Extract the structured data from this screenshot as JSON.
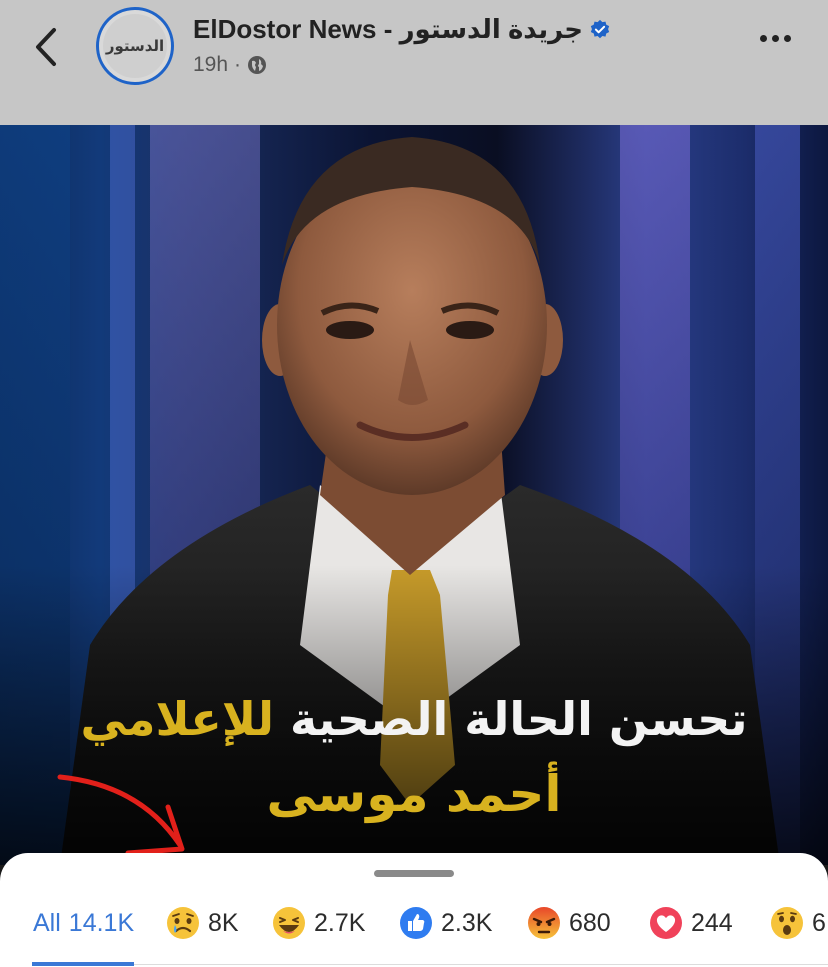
{
  "header": {
    "page_name": "ElDostor News - جريدة الدستور",
    "time": "19h",
    "dot": "·",
    "avatar_text": "الدستور"
  },
  "post": {
    "headline_line1_white": "تحسن الحالة الصحية",
    "headline_line1_gold": "للإعلامي",
    "headline_line2": "أحمد موسى"
  },
  "reactions": {
    "all": {
      "label": "All",
      "count": "14.1K"
    },
    "tabs": [
      {
        "icon": "sad-emoji-icon",
        "count": "8K"
      },
      {
        "icon": "haha-emoji-icon",
        "count": "2.7K"
      },
      {
        "icon": "like-icon",
        "count": "2.3K"
      },
      {
        "icon": "angry-emoji-icon",
        "count": "680"
      },
      {
        "icon": "love-heart-icon",
        "count": "244"
      },
      {
        "icon": "wow-emoji-icon",
        "count": "6"
      }
    ]
  },
  "colors": {
    "accent_blue": "#3a78d6",
    "gold": "#d8b21f",
    "avatar_ring": "#1e63c8",
    "arrow_red": "#e2201a"
  }
}
